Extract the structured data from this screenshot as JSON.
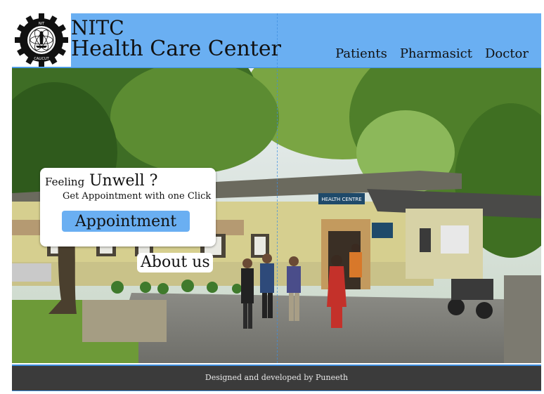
{
  "header": {
    "logo_icon": "nitc-emblem-icon",
    "logo_text": "NATIONAL INSTITUTE OF TECHNOLOGY CALICUT",
    "title_line1": "NITC",
    "title_line2": "Health Care Center",
    "background_color": "#6aaff2"
  },
  "nav": {
    "items": [
      {
        "label": "Patients"
      },
      {
        "label": "Pharmasict"
      },
      {
        "label": "Doctor"
      }
    ]
  },
  "hero": {
    "image": "health-centre-building-photo",
    "building_sign": "HEALTH CENTRE",
    "card": {
      "feeling_label": "Feeling",
      "unwell_label": "Unwell ?",
      "subtitle": "Get Appointment with one Click",
      "button_label": "Appointment"
    },
    "about_label": "About us"
  },
  "footer": {
    "text": "Designed and developed by Puneeth",
    "background_color": "#3b3b3b"
  }
}
